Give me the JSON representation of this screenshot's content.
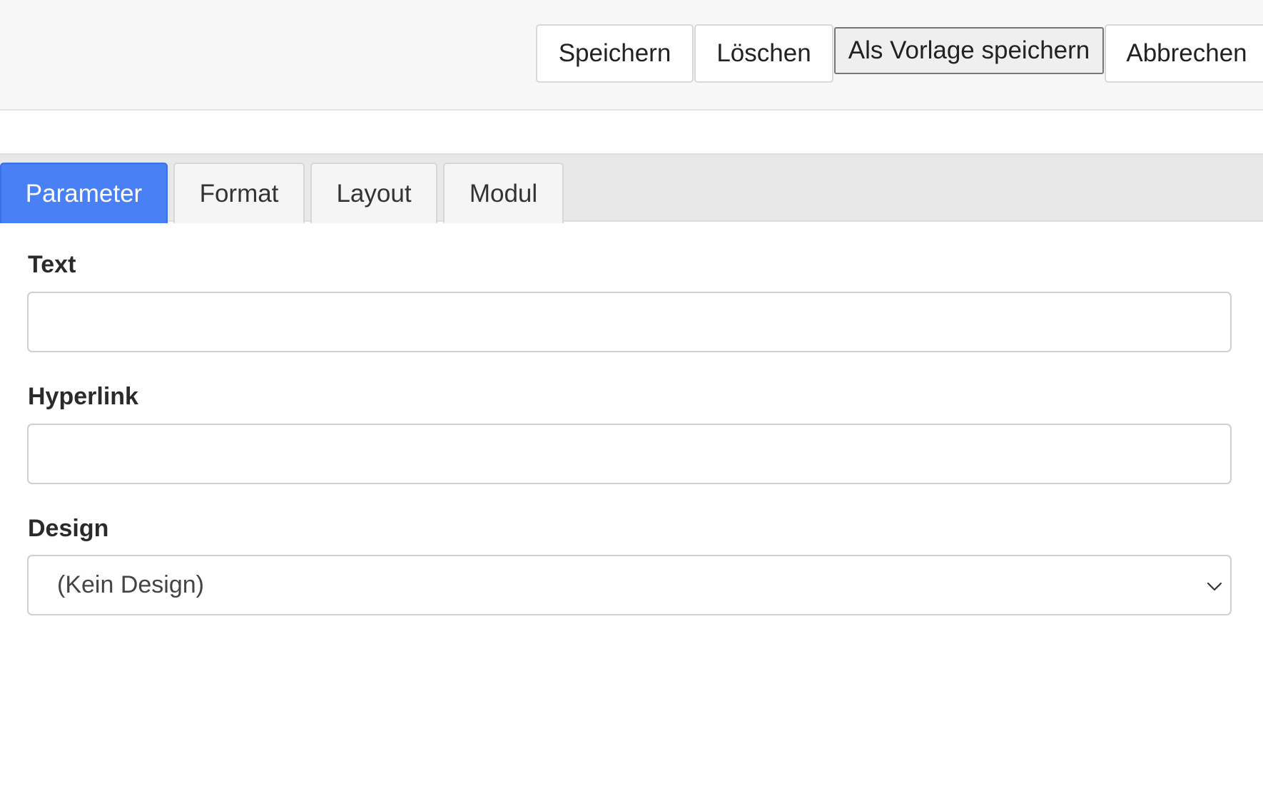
{
  "toolbar": {
    "save_label": "Speichern",
    "delete_label": "Löschen",
    "save_template_label": "Als Vorlage speichern",
    "cancel_label": "Abbrechen"
  },
  "tabs": [
    {
      "label": "Parameter",
      "active": true
    },
    {
      "label": "Format",
      "active": false
    },
    {
      "label": "Layout",
      "active": false
    },
    {
      "label": "Modul",
      "active": false
    }
  ],
  "form": {
    "text": {
      "label": "Text",
      "value": "",
      "placeholder": ""
    },
    "hyperlink": {
      "label": "Hyperlink",
      "value": "",
      "placeholder": ""
    },
    "design": {
      "label": "Design",
      "selected": "(Kein Design)"
    }
  },
  "colors": {
    "accent": "#4a80f5",
    "toolbar_bg": "#f7f7f7",
    "tabbar_bg": "#e8e8e8"
  },
  "icons": {
    "select": "chevron-down-icon"
  }
}
